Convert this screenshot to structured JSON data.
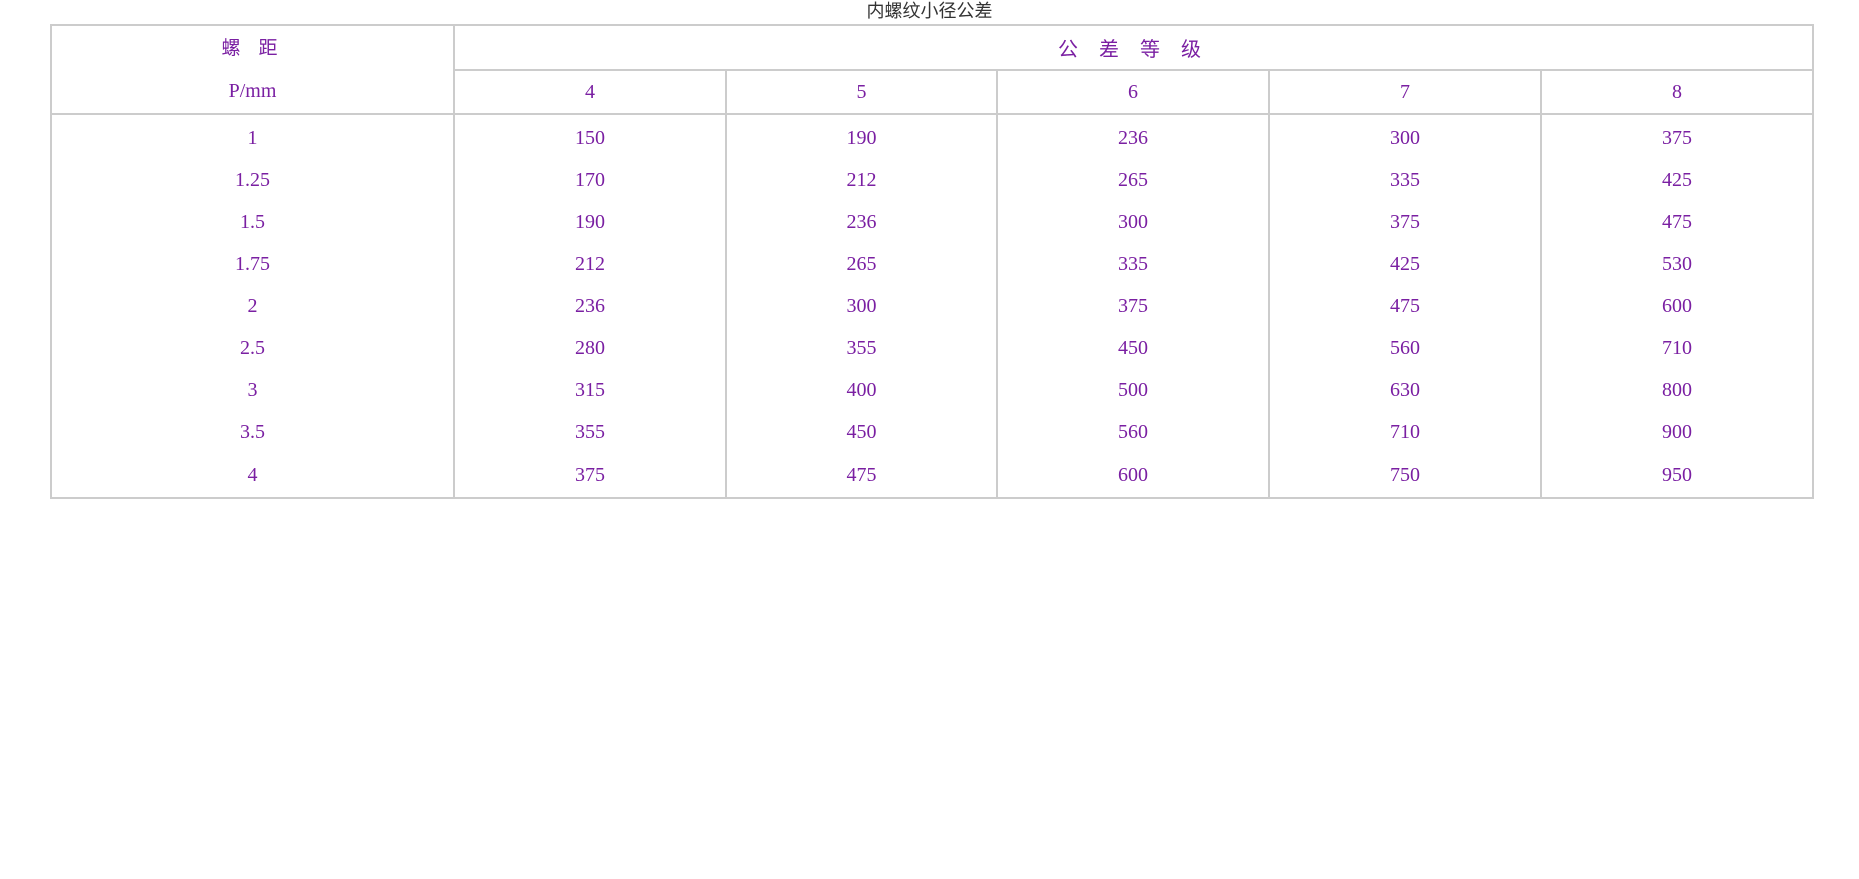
{
  "title": "内螺纹小径公差",
  "table": {
    "pitch_label": "螺 距",
    "pitch_unit": "P/mm",
    "grade_label": "公 差 等 级",
    "grades": [
      "4",
      "5",
      "6",
      "7",
      "8"
    ],
    "rows": [
      {
        "pitch": "1",
        "values": [
          "150",
          "190",
          "236",
          "300",
          "375"
        ]
      },
      {
        "pitch": "1.25",
        "values": [
          "170",
          "212",
          "265",
          "335",
          "425"
        ]
      },
      {
        "pitch": "1.5",
        "values": [
          "190",
          "236",
          "300",
          "375",
          "475"
        ]
      },
      {
        "pitch": "1.75",
        "values": [
          "212",
          "265",
          "335",
          "425",
          "530"
        ]
      },
      {
        "pitch": "2",
        "values": [
          "236",
          "300",
          "375",
          "475",
          "600"
        ]
      },
      {
        "pitch": "2.5",
        "values": [
          "280",
          "355",
          "450",
          "560",
          "710"
        ]
      },
      {
        "pitch": "3",
        "values": [
          "315",
          "400",
          "500",
          "630",
          "800"
        ]
      },
      {
        "pitch": "3.5",
        "values": [
          "355",
          "450",
          "560",
          "710",
          "900"
        ]
      },
      {
        "pitch": "4",
        "values": [
          "375",
          "475",
          "600",
          "750",
          "950"
        ]
      }
    ]
  },
  "colors": {
    "text": "#7a1fa2",
    "caption": "#333333",
    "border": "#cccccc"
  }
}
